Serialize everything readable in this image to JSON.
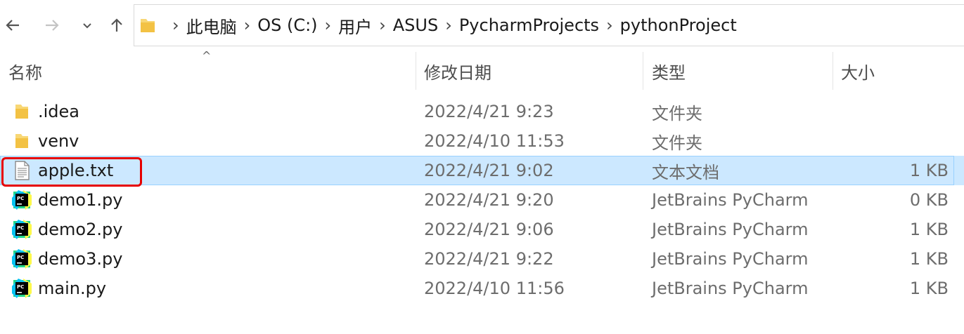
{
  "toolbar": {
    "back_icon": "arrow-left-icon",
    "forward_icon": "arrow-right-icon",
    "recent_icon": "chevron-down-icon",
    "up_icon": "arrow-up-icon"
  },
  "breadcrumb": [
    "此电脑",
    "OS (C:)",
    "用户",
    "ASUS",
    "PycharmProjects",
    "pythonProject"
  ],
  "columns": {
    "name": "名称",
    "date": "修改日期",
    "type": "类型",
    "size": "大小"
  },
  "sort_indicator": "^",
  "files": [
    {
      "name": ".idea",
      "date": "2022/4/21 9:23",
      "type": "文件夹",
      "size": "",
      "icon": "folder-icon"
    },
    {
      "name": "venv",
      "date": "2022/4/10 11:53",
      "type": "文件夹",
      "size": "",
      "icon": "folder-icon"
    },
    {
      "name": "apple.txt",
      "date": "2022/4/21 9:02",
      "type": "文本文档",
      "size": "1 KB",
      "icon": "text-file-icon",
      "selected": true
    },
    {
      "name": "demo1.py",
      "date": "2022/4/21 9:20",
      "type": "JetBrains PyCharm",
      "size": "0 KB",
      "icon": "pycharm-icon"
    },
    {
      "name": "demo2.py",
      "date": "2022/4/21 9:06",
      "type": "JetBrains PyCharm",
      "size": "1 KB",
      "icon": "pycharm-icon"
    },
    {
      "name": "demo3.py",
      "date": "2022/4/21 9:22",
      "type": "JetBrains PyCharm",
      "size": "1 KB",
      "icon": "pycharm-icon"
    },
    {
      "name": "main.py",
      "date": "2022/4/10 11:56",
      "type": "JetBrains PyCharm",
      "size": "1 KB",
      "icon": "pycharm-icon"
    }
  ],
  "colors": {
    "selection": "#cce8ff",
    "selection_border": "#99d1ff",
    "annotation": "#e60000",
    "folder": "#f8d775"
  }
}
